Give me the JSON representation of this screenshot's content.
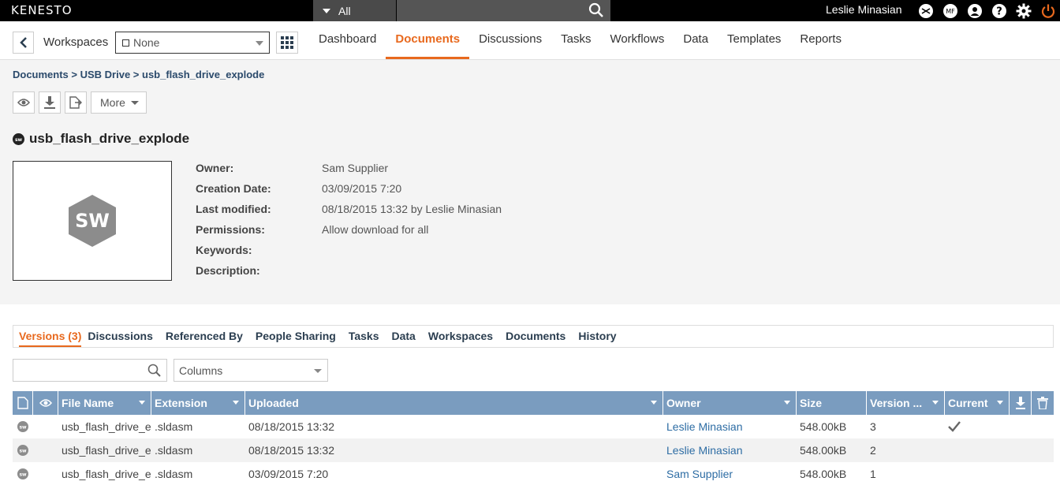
{
  "app": {
    "logo": "KENESTO",
    "user_name": "Leslie Minasian"
  },
  "top_search": {
    "scope": "All",
    "placeholder": ""
  },
  "top_icons": [
    "mail-icon",
    "mf2-icon",
    "user-icon",
    "help-icon",
    "gear-icon",
    "power-icon"
  ],
  "colors": {
    "accent": "#e8691e",
    "header_bg": "#7a9cbf",
    "link": "#2e6da4",
    "topbar": "#000000"
  },
  "nav": {
    "workspaces_label": "Workspaces",
    "workspace_selected": "None",
    "tabs": [
      "Dashboard",
      "Documents",
      "Discussions",
      "Tasks",
      "Workflows",
      "Data",
      "Templates",
      "Reports"
    ],
    "active_tab": "Documents"
  },
  "breadcrumb": "Documents > USB Drive > usb_flash_drive_explode",
  "toolbar": {
    "more_label": "More"
  },
  "document": {
    "title": "usb_flash_drive_explode",
    "thumb_text": "SW",
    "mini_icon_text": "sw",
    "properties": [
      {
        "label": "Owner:",
        "value": "Sam Supplier"
      },
      {
        "label": "Creation Date:",
        "value": "03/09/2015 7:20"
      },
      {
        "label": "Last modified:",
        "value": "08/18/2015 13:32 by Leslie Minasian"
      },
      {
        "label": "Permissions:",
        "value": "Allow download for all"
      },
      {
        "label": "Keywords:",
        "value": ""
      },
      {
        "label": "Description:",
        "value": ""
      }
    ]
  },
  "subtabs": [
    "Versions (3)",
    "Discussions",
    "Referenced By",
    "People Sharing",
    "Tasks",
    "Data",
    "Workspaces",
    "Documents",
    "History"
  ],
  "table": {
    "search_placeholder": "",
    "columns_label": "Columns",
    "headers": {
      "file_name": "File Name",
      "extension": "Extension",
      "uploaded": "Uploaded",
      "owner": "Owner",
      "size": "Size",
      "version": "Version ...",
      "current": "Current"
    },
    "rows": [
      {
        "file_name": "usb_flash_drive_ex",
        "extension": ".sldasm",
        "uploaded": "08/18/2015 13:32",
        "owner": "Leslie Minasian",
        "size": "548.00kB",
        "version": "3",
        "current": true
      },
      {
        "file_name": "usb_flash_drive_ex",
        "extension": ".sldasm",
        "uploaded": "08/18/2015 13:32",
        "owner": "Leslie Minasian",
        "size": "548.00kB",
        "version": "2",
        "current": false
      },
      {
        "file_name": "usb_flash_drive_ex",
        "extension": ".sldasm",
        "uploaded": "03/09/2015 7:20",
        "owner": "Sam Supplier",
        "size": "548.00kB",
        "version": "1",
        "current": false
      }
    ]
  }
}
